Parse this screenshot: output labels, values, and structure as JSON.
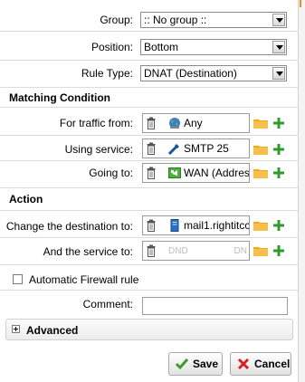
{
  "form": {
    "group": {
      "label": "Group:",
      "value": ":: No group ::"
    },
    "position": {
      "label": "Position:",
      "value": "Bottom"
    },
    "rule_type": {
      "label": "Rule Type:",
      "value": "DNAT (Destination)"
    }
  },
  "matching": {
    "title": "Matching Condition",
    "traffic_from": {
      "label": "For traffic from:",
      "value": "Any",
      "icon": "globe-icon"
    },
    "using_service": {
      "label": "Using service:",
      "value": "SMTP 25",
      "icon": "service-icon"
    },
    "going_to": {
      "label": "Going to:",
      "value": "WAN (Addres",
      "icon": "interface-icon"
    }
  },
  "action": {
    "title": "Action",
    "change_destination": {
      "label": "Change the destination to:",
      "value": "mail1.rightitcc",
      "icon": "server-icon"
    },
    "and_service": {
      "label": "And the service to:",
      "value_left": "DND",
      "value_right": "DN"
    }
  },
  "firewall": {
    "label": "Automatic Firewall rule",
    "checked": false
  },
  "comment": {
    "label": "Comment:",
    "value": ""
  },
  "advanced": {
    "label": "Advanced"
  },
  "buttons": {
    "save": "Save",
    "cancel": "Cancel"
  },
  "colors": {
    "folder": "#f2a81d",
    "plus": "#2e9d2e",
    "cancel_x": "#d42020",
    "save_check": "#3a9a2a"
  }
}
